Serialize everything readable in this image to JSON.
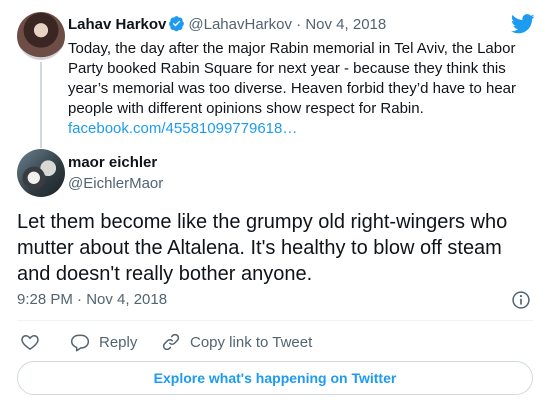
{
  "parent_tweet": {
    "author_name": "Lahav Harkov",
    "author_handle": "@LahavHarkov",
    "separator": "·",
    "date": "Nov 4, 2018",
    "text": "Today, the day after the major Rabin memorial in Tel Aviv, the Labor Party booked Rabin Square for next year - because they think this year’s memorial was too diverse. Heaven forbid they’d have to hear people with different opinions show respect for Rabin.",
    "link": "facebook.com/45581099779618…"
  },
  "reply_tweet": {
    "author_name": "maor eichler",
    "author_handle": "@EichlerMaor",
    "text": "Let them become like the grumpy old right-wingers who mutter about the Altalena. It's healthy to blow off steam and doesn't really bother anyone.",
    "timestamp": "9:28 PM · Nov 4, 2018"
  },
  "actions": {
    "reply_label": "Reply",
    "copy_label": "Copy link to Tweet"
  },
  "explore_label": "Explore what's happening on Twitter",
  "colors": {
    "accent": "#1d9bf0",
    "text": "#0f1419",
    "muted": "#536471",
    "border": "#cfd9de"
  },
  "icons": [
    "verified-badge-icon",
    "twitter-logo-icon",
    "info-icon",
    "heart-icon",
    "reply-icon",
    "link-icon"
  ]
}
